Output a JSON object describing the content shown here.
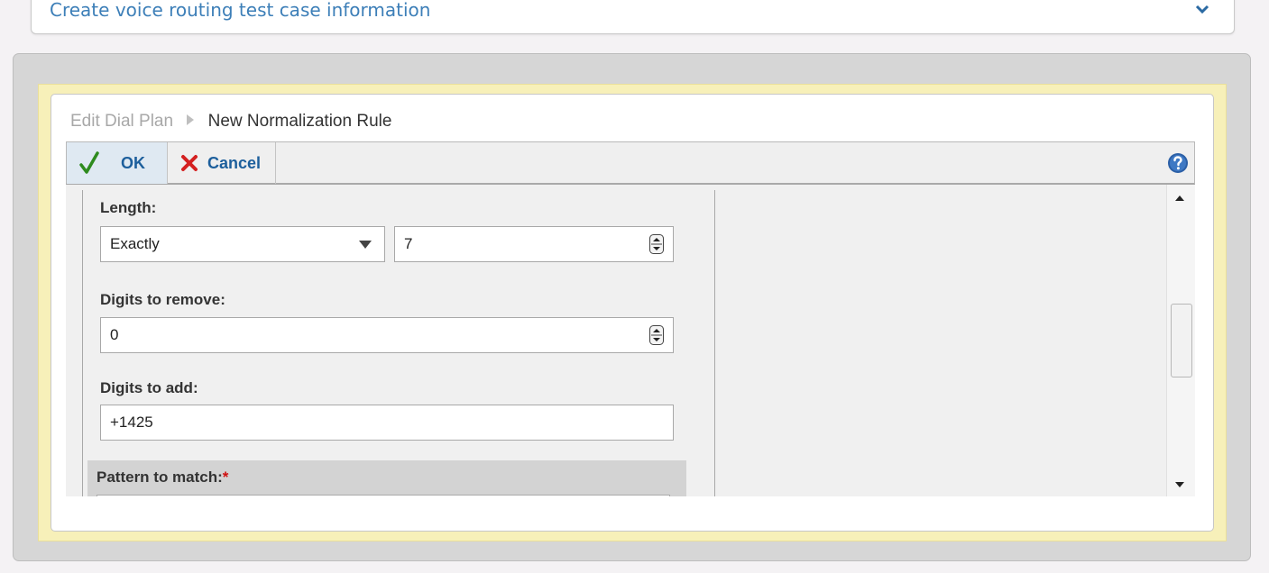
{
  "top_section": {
    "title": "Create voice routing test case information",
    "toggle_icon": "chevron-down-icon"
  },
  "breadcrumb": {
    "parent": "Edit Dial Plan",
    "current": "New Normalization Rule"
  },
  "toolbar": {
    "ok_label": "OK",
    "cancel_label": "Cancel",
    "help_icon": "help-icon"
  },
  "form": {
    "length": {
      "label": "Length:",
      "mode_value": "Exactly",
      "number_value": "7"
    },
    "digits_to_remove": {
      "label": "Digits to remove:",
      "value": "0"
    },
    "digits_to_add": {
      "label": "Digits to add:",
      "value": "+1425"
    },
    "pattern_to_match": {
      "label": "Pattern to match:",
      "required_marker": "*"
    }
  },
  "colors": {
    "accent_blue": "#1d5f9c",
    "link_blue": "#3d7fb8",
    "required_red": "#d01010",
    "ok_green": "#2e8b1e",
    "cancel_red": "#d42020",
    "highlight_yellow": "#f7f0b9"
  }
}
